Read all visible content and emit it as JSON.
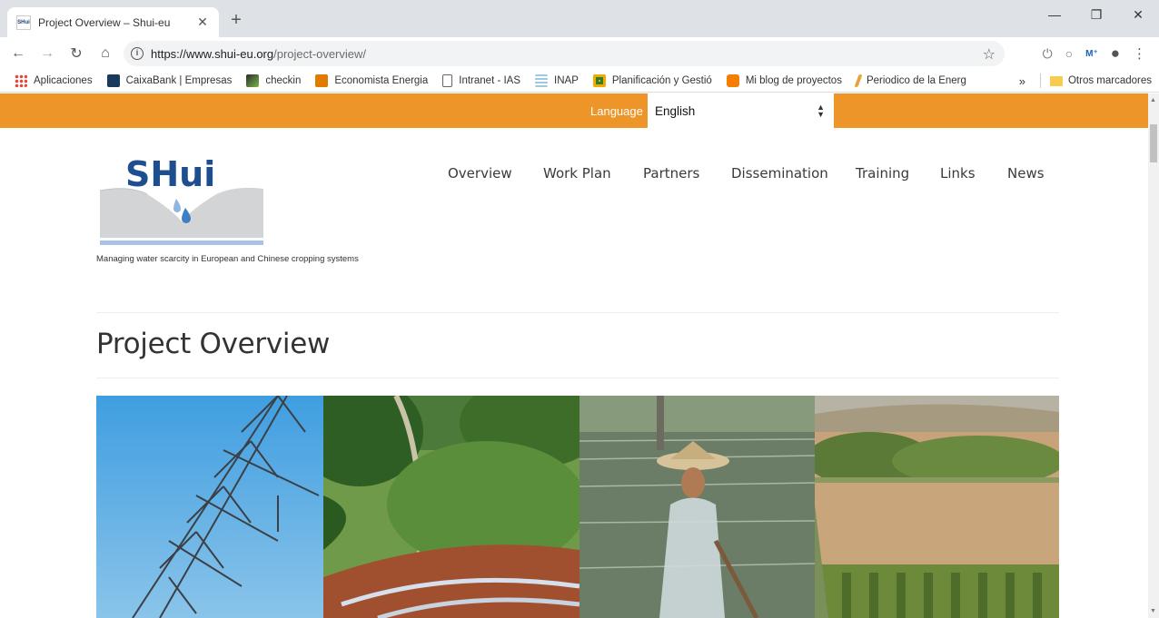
{
  "browser": {
    "tab_title": "Project Overview – Shui-eu",
    "favicon_text": "SHui",
    "url_host": "https://www.shui-eu.org",
    "url_path": "/project-overview/",
    "bookmarks": [
      {
        "label": "Aplicaciones",
        "color": "#4285f4"
      },
      {
        "label": "CaixaBank | Empresas",
        "color": "#1a3a5c"
      },
      {
        "label": "checkin",
        "color": "#2b2b2b"
      },
      {
        "label": "Economista Energia",
        "color": "#e07b00"
      },
      {
        "label": "Intranet - IAS",
        "color": "#ffffff"
      },
      {
        "label": "INAP",
        "color": "#9ecae1"
      },
      {
        "label": "Planificación y Gestió",
        "color": "#f2a900"
      },
      {
        "label": "Mi blog de proyectos",
        "color": "#f57d00"
      },
      {
        "label": "Periodico de la Energ",
        "color": "#e8a33d"
      }
    ],
    "more_bookmarks": "»",
    "other_bookmarks": "Otros marcadores"
  },
  "language_bar": {
    "label": "Language",
    "selected": "English",
    "color": "#ed9529"
  },
  "site": {
    "logo_text": "SHui",
    "tagline": "Managing water scarcity in European and Chinese cropping systems",
    "nav": [
      "Overview",
      "Work Plan",
      "Partners",
      "Dissemination",
      "Training",
      "Links",
      "News"
    ]
  },
  "page": {
    "title": "Project Overview"
  }
}
